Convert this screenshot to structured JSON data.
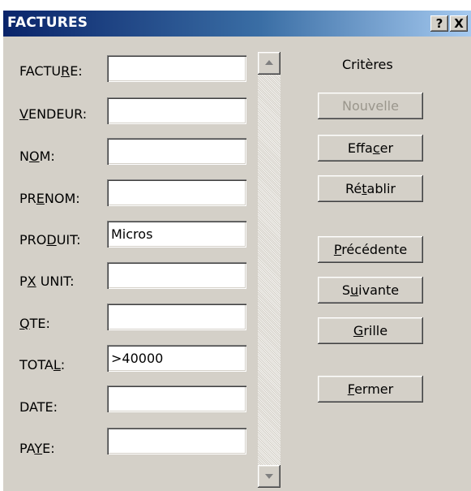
{
  "window": {
    "title": "FACTURES",
    "help_button": "?",
    "close_button": "X"
  },
  "fields": [
    {
      "pre": "FACTU",
      "acc": "R",
      "post": "E:",
      "value": ""
    },
    {
      "pre": "",
      "acc": "V",
      "post": "ENDEUR:",
      "value": ""
    },
    {
      "pre": "N",
      "acc": "O",
      "post": "M:",
      "value": ""
    },
    {
      "pre": "PR",
      "acc": "E",
      "post": "NOM:",
      "value": ""
    },
    {
      "pre": "PRO",
      "acc": "D",
      "post": "UIT:",
      "value": "Micros"
    },
    {
      "pre": "P",
      "acc": "X",
      "post": " UNIT:",
      "value": ""
    },
    {
      "pre": "",
      "acc": "Q",
      "post": "TE:",
      "value": ""
    },
    {
      "pre": "TOTA",
      "acc": "L",
      "post": ":",
      "value": ">40000"
    },
    {
      "pre": "DATE:",
      "acc": "",
      "post": "",
      "value": ""
    },
    {
      "pre": "PA",
      "acc": "Y",
      "post": "E:",
      "value": ""
    }
  ],
  "criteria_label": "Critères",
  "buttons": {
    "new": {
      "pre": "Nouvelle",
      "acc": "",
      "post": "",
      "enabled": false
    },
    "clear": {
      "pre": "Effa",
      "acc": "c",
      "post": "er",
      "enabled": true
    },
    "restore": {
      "pre": "Ré",
      "acc": "t",
      "post": "ablir",
      "enabled": true
    },
    "previous": {
      "pre": "",
      "acc": "P",
      "post": "récédente",
      "enabled": true
    },
    "next": {
      "pre": "S",
      "acc": "u",
      "post": "ivante",
      "enabled": true
    },
    "grid": {
      "pre": "",
      "acc": "G",
      "post": "rille",
      "enabled": true
    },
    "close": {
      "pre": "",
      "acc": "F",
      "post": "ermer",
      "enabled": true
    }
  },
  "icons": {
    "scroll_up": "scroll-up-arrow-icon",
    "scroll_down": "scroll-down-arrow-icon"
  }
}
